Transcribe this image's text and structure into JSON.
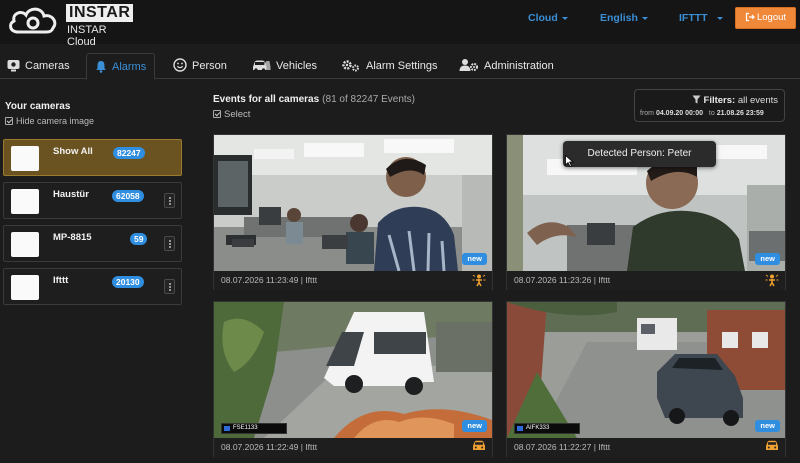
{
  "brand": {
    "name": "INSTAR",
    "sub": "INSTAR Cloud"
  },
  "topnav": {
    "cloud": "Cloud",
    "language": "English",
    "ifttt": "IFTTT",
    "logout": "Logout"
  },
  "tabs": [
    {
      "label": "Cameras",
      "icon": "camera-icon"
    },
    {
      "label": "Alarms",
      "icon": "bell-icon"
    },
    {
      "label": "Person",
      "icon": "smiley-icon"
    },
    {
      "label": "Vehicles",
      "icon": "car-icon"
    },
    {
      "label": "Alarm Settings",
      "icon": "gears-icon"
    },
    {
      "label": "Administration",
      "icon": "users-gear-icon"
    }
  ],
  "sidebar": {
    "title": "Your cameras",
    "hide_label": "Hide camera image",
    "cameras": [
      {
        "name": "Show All",
        "count": "82247"
      },
      {
        "name": "Haustür",
        "count": "62058"
      },
      {
        "name": "MP-8815",
        "count": "59"
      },
      {
        "name": "Ifttt",
        "count": "20130"
      }
    ]
  },
  "events": {
    "title": "Events for all cameras",
    "count": "(81 of 82247 Events)",
    "select_label": "Select",
    "filters": {
      "label": "Filters:",
      "value": "all events",
      "from_label": "from",
      "from": "04.09.20 00:00",
      "to_label": "to",
      "to": "21.08.26 23:59"
    },
    "cards": [
      {
        "time": "08.07.2026 11:23:49 | Ifttt",
        "badge": "new",
        "icon": "person-alarm-icon"
      },
      {
        "time": "08.07.2026 11:23:26 | Ifttt",
        "badge": "new",
        "icon": "person-alarm-icon",
        "tooltip": "Detected Person: Peter"
      },
      {
        "time": "08.07.2026 11:22:49 | Ifttt",
        "badge": "new",
        "icon": "car-icon",
        "plate": "FSE1133"
      },
      {
        "time": "08.07.2026 11:22:27 | Ifttt",
        "badge": "new",
        "icon": "car-icon",
        "plate": "AIFK333"
      }
    ]
  },
  "colors": {
    "accent": "#3a8fd6",
    "badge": "#2f8ee0",
    "logout": "#f0883a",
    "selected": "#6a5320",
    "alarm": "#f0a030"
  }
}
